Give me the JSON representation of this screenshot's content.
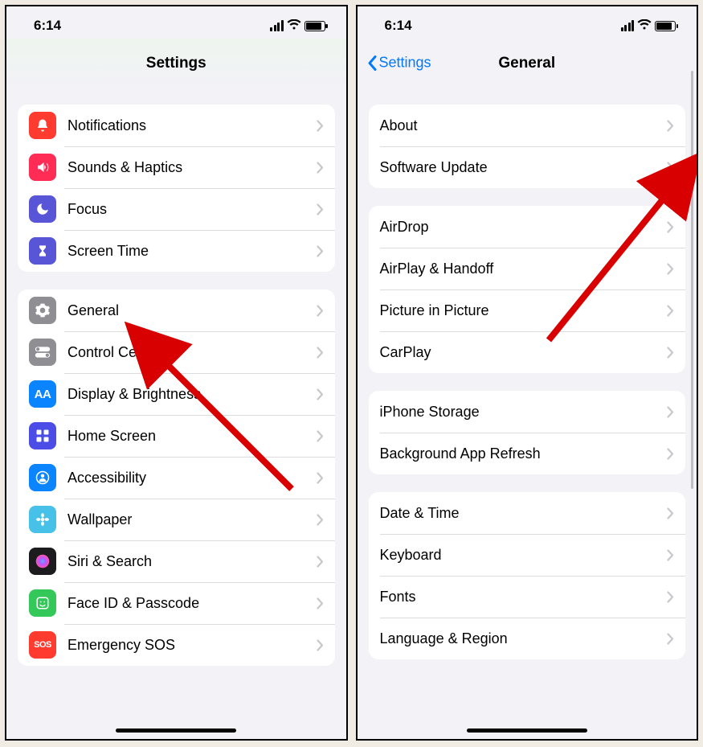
{
  "status": {
    "time": "6:14"
  },
  "screen1": {
    "title": "Settings",
    "group1": [
      {
        "id": "notifications",
        "label": "Notifications",
        "color": "#ff3b30",
        "glyph": "bell"
      },
      {
        "id": "sounds",
        "label": "Sounds & Haptics",
        "color": "#ff2d55",
        "glyph": "speaker"
      },
      {
        "id": "focus",
        "label": "Focus",
        "color": "#5856d6",
        "glyph": "moon"
      },
      {
        "id": "screentime",
        "label": "Screen Time",
        "color": "#5856d6",
        "glyph": "hourglass"
      }
    ],
    "group2": [
      {
        "id": "general",
        "label": "General",
        "color": "#8e8e93",
        "glyph": "gear"
      },
      {
        "id": "controlcentre",
        "label": "Control Centre",
        "color": "#8e8e93",
        "glyph": "toggles"
      },
      {
        "id": "display",
        "label": "Display & Brightness",
        "color": "#0a84ff",
        "glyph": "AA"
      },
      {
        "id": "homescreen",
        "label": "Home Screen",
        "color": "#4b4de6",
        "glyph": "grid"
      },
      {
        "id": "accessibility",
        "label": "Accessibility",
        "color": "#0a84ff",
        "glyph": "person"
      },
      {
        "id": "wallpaper",
        "label": "Wallpaper",
        "color": "#47c1e8",
        "glyph": "flower"
      },
      {
        "id": "siri",
        "label": "Siri & Search",
        "color": "#1c1c1e",
        "glyph": "siri"
      },
      {
        "id": "faceid",
        "label": "Face ID & Passcode",
        "color": "#34c759",
        "glyph": "face"
      },
      {
        "id": "sos",
        "label": "Emergency SOS",
        "color": "#ff3b30",
        "glyph": "SOS"
      }
    ]
  },
  "screen2": {
    "back": "Settings",
    "title": "General",
    "group1": [
      {
        "id": "about",
        "label": "About"
      },
      {
        "id": "software-update",
        "label": "Software Update"
      }
    ],
    "group2": [
      {
        "id": "airdrop",
        "label": "AirDrop"
      },
      {
        "id": "airplay",
        "label": "AirPlay & Handoff"
      },
      {
        "id": "pip",
        "label": "Picture in Picture"
      },
      {
        "id": "carplay",
        "label": "CarPlay"
      }
    ],
    "group3": [
      {
        "id": "storage",
        "label": "iPhone Storage"
      },
      {
        "id": "bgrefresh",
        "label": "Background App Refresh"
      }
    ],
    "group4": [
      {
        "id": "datetime",
        "label": "Date & Time"
      },
      {
        "id": "keyboard",
        "label": "Keyboard"
      },
      {
        "id": "fonts",
        "label": "Fonts"
      },
      {
        "id": "language",
        "label": "Language & Region"
      }
    ]
  }
}
